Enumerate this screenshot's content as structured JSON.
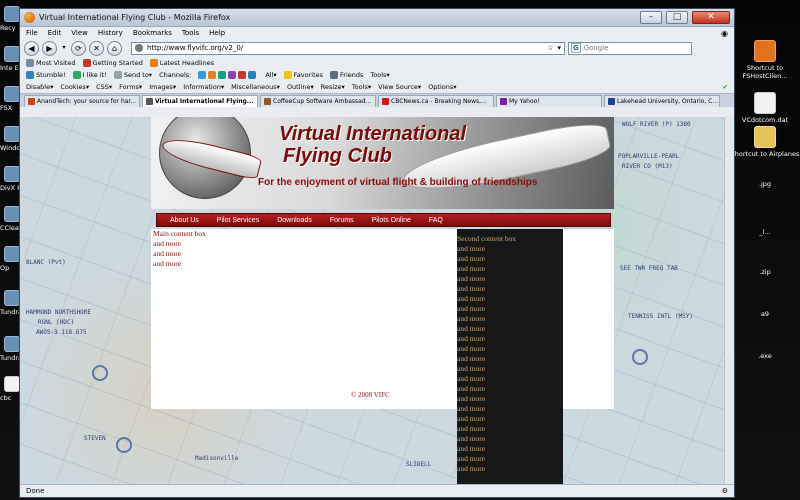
{
  "desktop": {
    "left_icons": [
      "Recy",
      "Inte Explo",
      "FSX",
      "Windo Me",
      "DivX P",
      "CClea",
      "Op",
      "Tundra",
      "Tundra",
      "cbc"
    ],
    "right_icons": [
      {
        "label": "Shortcut to FSHostClien..."
      },
      {
        "label": "VCdotcom.dat"
      },
      {
        "label": "Shortcut to Airplanes"
      },
      {
        "label": ".jpg"
      },
      {
        "label": "_l..."
      },
      {
        "label": ".zip"
      },
      {
        "label": "a9"
      },
      {
        "label": ".exe"
      }
    ]
  },
  "window": {
    "title": "Virtual International Flying Club - Mozilla Firefox",
    "controls": {
      "minimize": "–",
      "maximize": "□",
      "close": "✕"
    }
  },
  "menubar": {
    "items": [
      "File",
      "Edit",
      "View",
      "History",
      "Bookmarks",
      "Tools",
      "Help"
    ]
  },
  "navbar": {
    "back": "◀",
    "forward": "▶",
    "reload": "⟳",
    "stop": "✕",
    "home": "⌂",
    "url": "http://www.flyvifc.org/v2_0/",
    "search_placeholder": "Google",
    "search_engine": "G"
  },
  "bookmarks_toolbar": {
    "items": [
      "Most Visited",
      "Getting Started",
      "Latest Headlines"
    ]
  },
  "stumble_toolbar": {
    "items": [
      "Stumble!",
      "I like it!",
      "Send to▾",
      "Channels:",
      "All▾",
      "Favorites",
      "Friends",
      "Tools▾"
    ]
  },
  "webdev_toolbar": {
    "items": [
      "Disable▾",
      "Cookies▾",
      "CSS▾",
      "Forms▾",
      "Images▾",
      "Information▾",
      "Miscellaneous▾",
      "Outline▾",
      "Resize▾",
      "Tools▾",
      "View Source▾",
      "Options▾"
    ]
  },
  "tabs": [
    {
      "label": "AnandTech: your source for har...",
      "color": "#c24a1a",
      "active": false
    },
    {
      "label": "Virtual International Flying...",
      "color": "#555555",
      "active": true
    },
    {
      "label": "CoffeeCup Software Ambassad...",
      "color": "#8a5a2a",
      "active": false
    },
    {
      "label": "CBCNews.ca - Breaking News,...",
      "color": "#cc1a1a",
      "active": false
    },
    {
      "label": "My Yahoo!",
      "color": "#7b1fa2",
      "active": false
    },
    {
      "label": "Lakehead University, Ontario, C...",
      "color": "#1f3f8a",
      "active": false
    }
  ],
  "site": {
    "brand_line1": "Virtual International",
    "brand_line2": "Flying Club",
    "tagline": "For the enjoyment of virtual flight & building of friendships",
    "nav": [
      "About Us",
      "Pilot Services",
      "Downloads",
      "Forums",
      "Pilots Online",
      "FAQ"
    ],
    "main_box": {
      "title": "Main content box",
      "lines": [
        "and more",
        "and more",
        "and more"
      ]
    },
    "second_box": {
      "title": "Second content box",
      "lines": [
        "and more",
        "and more",
        "and more",
        "and more",
        "and more",
        "and more",
        "and more",
        "and more",
        "and more",
        "and more",
        "and more",
        "and more",
        "and more",
        "and more",
        "and more",
        "and more",
        "and more",
        "and more",
        "and more",
        "and more",
        "and more",
        "and more",
        "and more"
      ]
    },
    "footer": "© 2008 VIFC"
  },
  "sectional_labels": [
    "WOLF RIVER (P) 1380",
    "POPLARVILLE-PEARL",
    "RIVER CO (M13)",
    "BLANC (Pvt)",
    "HAMMOND NORTHSHORE",
    "RGNL (HDC)",
    "AWOS-3 118.675",
    "SEE TWR FREQ TAB",
    "TENNISS INTL (MSY)",
    "Madisonville",
    "STEVEN",
    "SLIDELL"
  ],
  "statusbar": {
    "left": "Done",
    "right": "⚙"
  }
}
